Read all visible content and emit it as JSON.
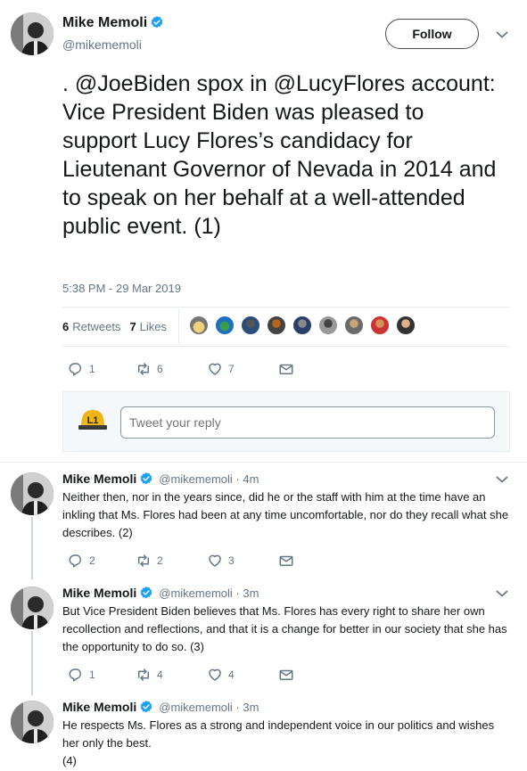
{
  "author": {
    "name": "Mike Memoli",
    "handle": "@mikememoli"
  },
  "follow_label": "Follow",
  "main_tweet": {
    "text": ". @JoeBiden spox in @LucyFlores account: Vice President Biden was pleased to support Lucy Flores’s candidacy for Lieutenant Governor of Nevada in 2014 and to speak on her behalf at a well-attended public event.  (1)",
    "timestamp": "5:38 PM - 29 Mar 2019",
    "retweets_count": "6",
    "retweets_label": "Retweets",
    "likes_count": "7",
    "likes_label": "Likes",
    "actions": {
      "replies": "1",
      "retweets": "6",
      "likes": "7"
    }
  },
  "reply_box": {
    "avatar_text": "L1",
    "placeholder": "Tweet your reply"
  },
  "replies": [
    {
      "name": "Mike Memoli",
      "handle_time": "@mikememoli · 4m",
      "text": "Neither then, nor in the years since, did he or the staff with him at the time have an inkling that Ms. Flores had been at any time uncomfortable, nor do they recall what she describes. (2)",
      "actions": {
        "replies": "2",
        "retweets": "2",
        "likes": "3"
      }
    },
    {
      "name": "Mike Memoli",
      "handle_time": "@mikememoli · 3m",
      "text": "But Vice President Biden believes that Ms. Flores has every right to share her own recollection and reflections, and that it is a change for better in our society that she has the opportunity to do so. (3)",
      "actions": {
        "replies": "1",
        "retweets": "4",
        "likes": "4"
      }
    },
    {
      "name": "Mike Memoli",
      "handle_time": "@mikememoli · 3m",
      "text": "He respects Ms. Flores as a strong and independent voice in our politics and wishes her only the best.",
      "text2": "(4)"
    }
  ],
  "colors": {
    "verified": "#1da1f2",
    "text": "#14171a",
    "muted": "#657786"
  }
}
